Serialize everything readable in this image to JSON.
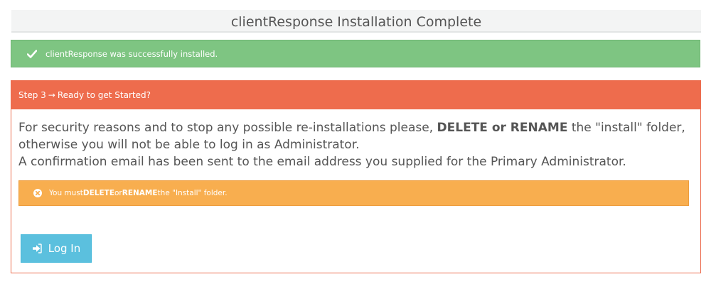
{
  "header": {
    "title": "clientResponse Installation Complete"
  },
  "success_alert": {
    "icon": "check-icon",
    "message": "clientResponse was successfully installed."
  },
  "panel": {
    "heading_prefix": "Step 3",
    "heading_arrow": "→",
    "heading_text": "Ready to get Started?",
    "body": {
      "line1_pre": "For security reasons and to stop any possible re-installations please, ",
      "line1_bold": "DELETE or RENAME",
      "line1_post": " the \"install\" folder,",
      "line2": "otherwise you will not be able to log in as Administrator.",
      "line3": "A confirmation email has been sent to the email address you supplied for the Primary Administrator."
    },
    "warning": {
      "icon": "times-circle-icon",
      "pre": "You must ",
      "bold1": "DELETE",
      "mid": " or ",
      "bold2": "RENAME",
      "post": " the \"Install\" folder."
    },
    "login_button": {
      "icon": "sign-in-icon",
      "label": "Log In"
    }
  },
  "colors": {
    "success": "#7ec582",
    "danger_heading": "#ee6c4d",
    "warning": "#f8ae4f",
    "info_button": "#5bc0de"
  }
}
